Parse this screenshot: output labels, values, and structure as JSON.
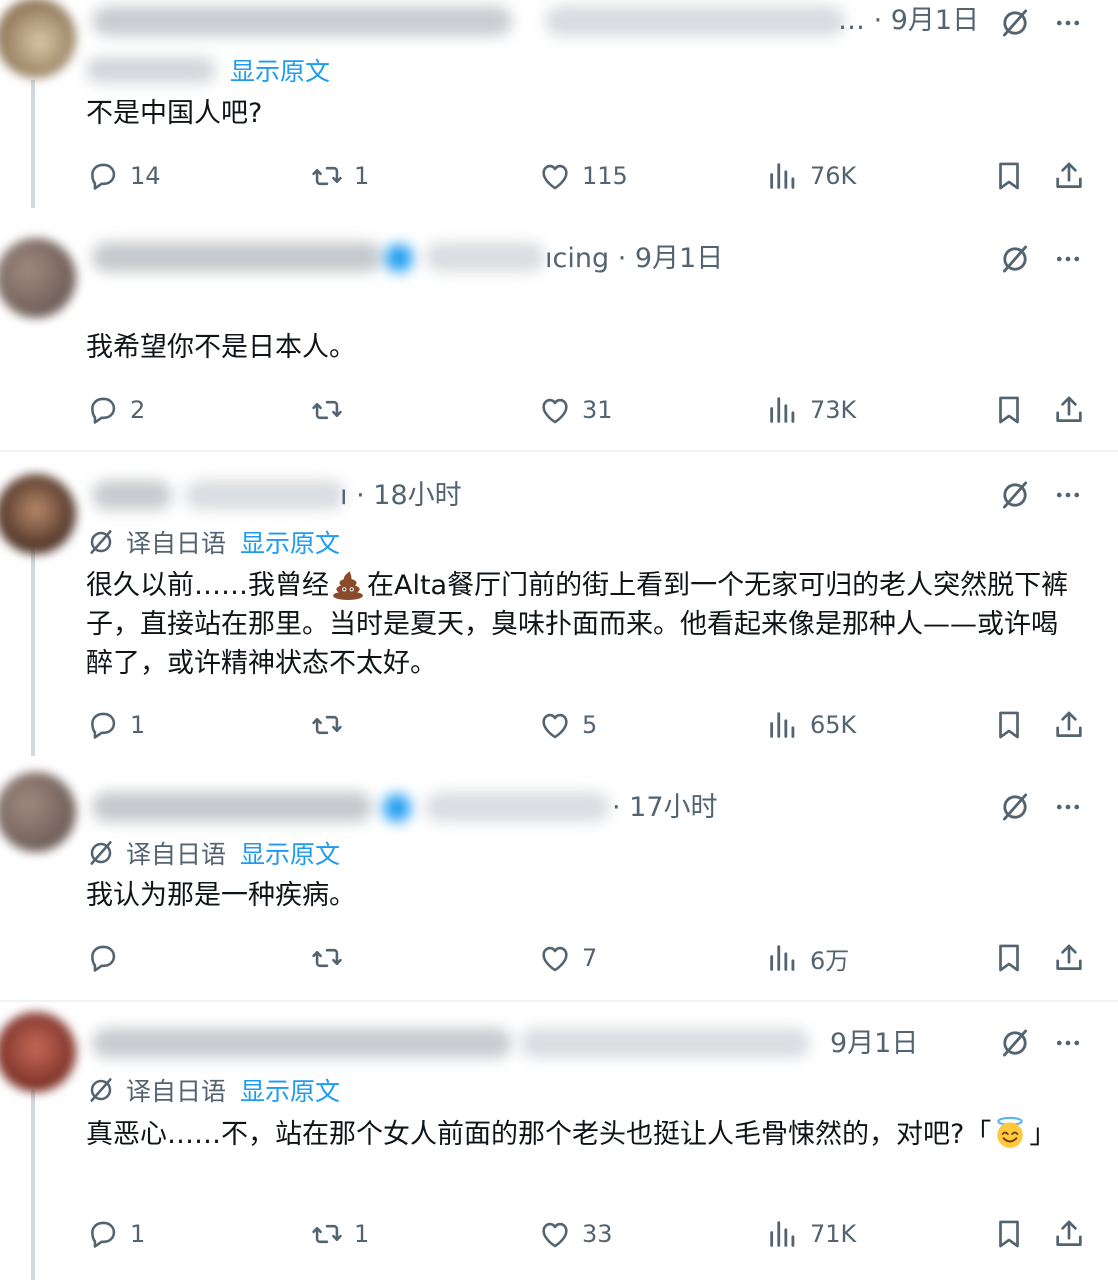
{
  "colors": {
    "link": "#1d9bf0",
    "muted": "#536471",
    "text": "#0f1419",
    "divider": "#eff3f4",
    "thread": "#cfd9de"
  },
  "labels": {
    "translated_from": "译自日语",
    "show_original": "显示原文"
  },
  "tweets": [
    {
      "time": "· 9月1日",
      "handle_tail": "…",
      "show_original": "显示原文",
      "text": "不是中国人吧?",
      "replies": "14",
      "reposts": "1",
      "likes": "115",
      "views": "76K"
    },
    {
      "time": "· 9月1日",
      "handle_tail": "ıcing",
      "text": "我希望你不是日本人。",
      "replies": "2",
      "reposts": "",
      "likes": "31",
      "views": "73K"
    },
    {
      "time": "· 18小时",
      "handle_tail": "ı",
      "text_before": "很久以前……我曾经",
      "text_after": "在Alta餐厅门前的街上看到一个无家可归的老人突然脱下裤子，直接站在那里。当时是夏天，臭味扑面而来。他看起来像是那种人——或许喝醉了，或许精神状态不太好。",
      "emoji": "pile-of-poo-emoji",
      "replies": "1",
      "reposts": "",
      "likes": "5",
      "views": "65K"
    },
    {
      "time": "· 17小时",
      "handle_tail": "",
      "text": "我认为那是一种疾病。",
      "replies": "",
      "reposts": "",
      "likes": "7",
      "views": "6万"
    },
    {
      "time": "9月1日",
      "handle_tail": "",
      "text_before": "真恶心……不，站在那个女人前面的那个老头也挺让人毛骨悚然的，对吧?「",
      "text_after": "」",
      "emoji": "smiling-face-with-halo-emoji",
      "replies": "1",
      "reposts": "1",
      "likes": "33",
      "views": "71K"
    }
  ]
}
